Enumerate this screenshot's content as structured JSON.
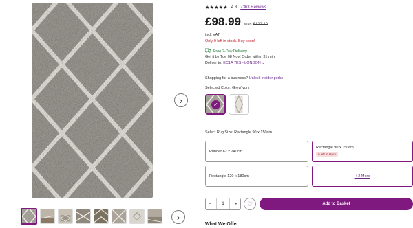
{
  "rating": {
    "stars": "★★★★★",
    "value": "4.8",
    "reviews_link": "7363 Reviews"
  },
  "price": {
    "current": "£98.99",
    "was_label": "was",
    "was_price": "£122.40"
  },
  "vat": "incl. VAT",
  "stock_warning": "Only 9 left in stock. Buy soon!",
  "delivery": {
    "truck_icon": "truck-icon",
    "free": "Free 2-Day Delivery",
    "get_it": "Get it by Tue 08 Nov! Order within 31 min.",
    "deliver_to_label": "Deliver to:",
    "location": "EC1A 7ES - LONDON",
    "chevron": "⌄"
  },
  "business": {
    "text": "Shopping for a business?",
    "link": "Unlock insider perks"
  },
  "color": {
    "label": "Selected Color: Grey/Ivory",
    "check_icon": "check-icon",
    "swatches": [
      "Grey/Ivory",
      "Ivory/Grey"
    ]
  },
  "size": {
    "label": "Select Rug Size: Rectangle 90 x 150cm",
    "options": [
      {
        "label": "Runner 62 x 240cm"
      },
      {
        "label": "Rectangle 90 x 150cm",
        "badge": "9 left in stock"
      },
      {
        "label": "Rectangle 120 x 180cm"
      },
      {
        "label": "+ 2 More"
      }
    ]
  },
  "cart": {
    "minus": "−",
    "quantity": "1",
    "plus": "+",
    "wishlist_icon": "heart-icon",
    "add_label": "Add to Basket"
  },
  "offer_heading": "What We Offer",
  "gallery": {
    "next_icon": "chevron-right-icon",
    "arrow": "›"
  },
  "colors": {
    "accent": "#7f187f",
    "rug_grey": "#a39f99",
    "rug_ivory": "#efece6",
    "stock_red": "#c0222e",
    "delivery_green": "#1d7a34"
  }
}
